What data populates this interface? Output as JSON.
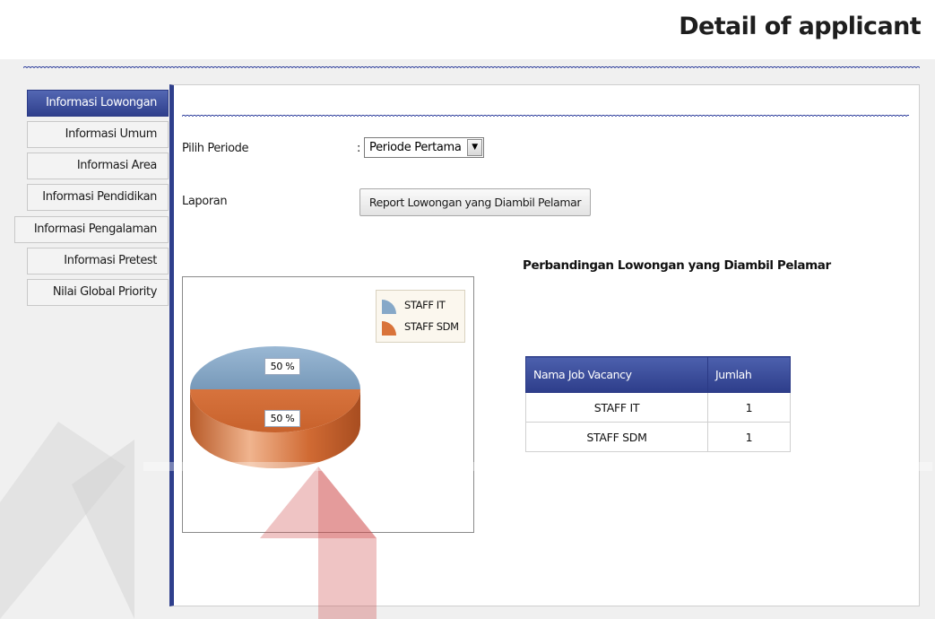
{
  "header": {
    "title": "Detail of applicant"
  },
  "sidebar": {
    "items": [
      {
        "label": "Informasi Lowongan",
        "active": true
      },
      {
        "label": "Informasi Umum"
      },
      {
        "label": "Informasi Area"
      },
      {
        "label": "Informasi Pendidikan"
      },
      {
        "label": "Informasi Pengalaman"
      },
      {
        "label": "Informasi Pretest"
      },
      {
        "label": "Nilai Global Priority"
      }
    ]
  },
  "form": {
    "period_label": "Pilih Periode",
    "period_colon": ":",
    "period_selected": "Periode Pertama",
    "report_label": "Laporan",
    "report_button": "Report Lowongan yang Diambil Pelamar"
  },
  "chart_data": {
    "type": "pie",
    "title": "Perbandingan Lowongan yang Diambil Pelamar",
    "categories": [
      "STAFF IT",
      "STAFF SDM"
    ],
    "values": [
      1,
      1
    ],
    "percent_labels": [
      "50 %",
      "50 %"
    ],
    "colors": [
      "#86a8c8",
      "#d9733a"
    ],
    "legend_position": "top-right",
    "three_d": true
  },
  "table": {
    "headers": [
      "Nama Job Vacancy",
      "Jumlah"
    ],
    "rows": [
      [
        "STAFF IT",
        "1"
      ],
      [
        "STAFF SDM",
        "1"
      ]
    ]
  },
  "colors": {
    "accent": "#2f3f8c",
    "slice_it": "#86a8c8",
    "slice_sdm": "#d9733a"
  }
}
